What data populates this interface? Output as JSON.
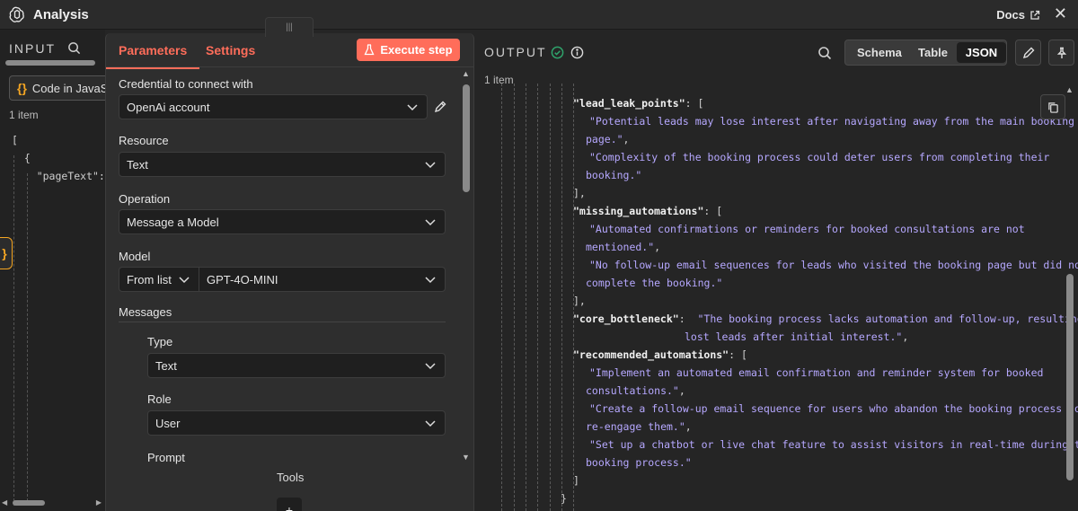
{
  "app": {
    "title": "Analysis",
    "docs_label": "Docs"
  },
  "input": {
    "header": "INPUT",
    "node_label": "Code in JavaScript",
    "item_count": "1 item",
    "json_lines": [
      "[",
      "  {",
      "    \"pageText\":"
    ]
  },
  "params": {
    "tabs": [
      {
        "label": "Parameters",
        "active": true
      },
      {
        "label": "Settings",
        "active": false
      }
    ],
    "execute_label": "Execute step",
    "credential": {
      "label": "Credential to connect with",
      "value": "OpenAi account"
    },
    "resource": {
      "label": "Resource",
      "value": "Text"
    },
    "operation": {
      "label": "Operation",
      "value": "Message a Model"
    },
    "model": {
      "label": "Model",
      "mode": "From list",
      "value": "GPT-4O-MINI"
    },
    "messages": {
      "label": "Messages",
      "type": {
        "label": "Type",
        "value": "Text"
      },
      "role": {
        "label": "Role",
        "value": "User"
      },
      "prompt_label": "Prompt"
    },
    "tools_label": "Tools",
    "add_label": "+"
  },
  "output": {
    "header": "OUTPUT",
    "item_count": "1 item",
    "views": [
      "Schema",
      "Table",
      "JSON"
    ],
    "active_view": "JSON",
    "json": {
      "lead_leak_points_key": "\"lead_leak_points\"",
      "lead_leak_points": [
        "\"Potential leads may lose interest after navigating away from the main booking",
        "page.\"",
        "\"Complexity of the booking process could deter users from completing their",
        "booking.\""
      ],
      "missing_automations_key": "\"missing_automations\"",
      "missing_automations": [
        "\"Automated confirmations or reminders for booked consultations are not",
        "mentioned.\"",
        "\"No follow-up email sequences for leads who visited the booking page but did not",
        "complete the booking.\""
      ],
      "core_bottleneck_key": "\"core_bottleneck\"",
      "core_bottleneck": [
        "\"The booking process lacks automation and follow-up, resulting in",
        "lost leads after initial interest.\""
      ],
      "recommended_automations_key": "\"recommended_automations\"",
      "recommended_automations": [
        "\"Implement an automated email confirmation and reminder system for booked",
        "consultations.\"",
        "\"Create a follow-up email sequence for users who abandon the booking process to",
        "re-engage them.\"",
        "\"Set up a chatbot or live chat feature to assist visitors in real-time during the",
        "booking process.\""
      ]
    }
  },
  "colors": {
    "accent": "#ff6d5a",
    "string": "#b6a8ff",
    "success": "#2fa36b",
    "code_brace": "#f5a623"
  }
}
